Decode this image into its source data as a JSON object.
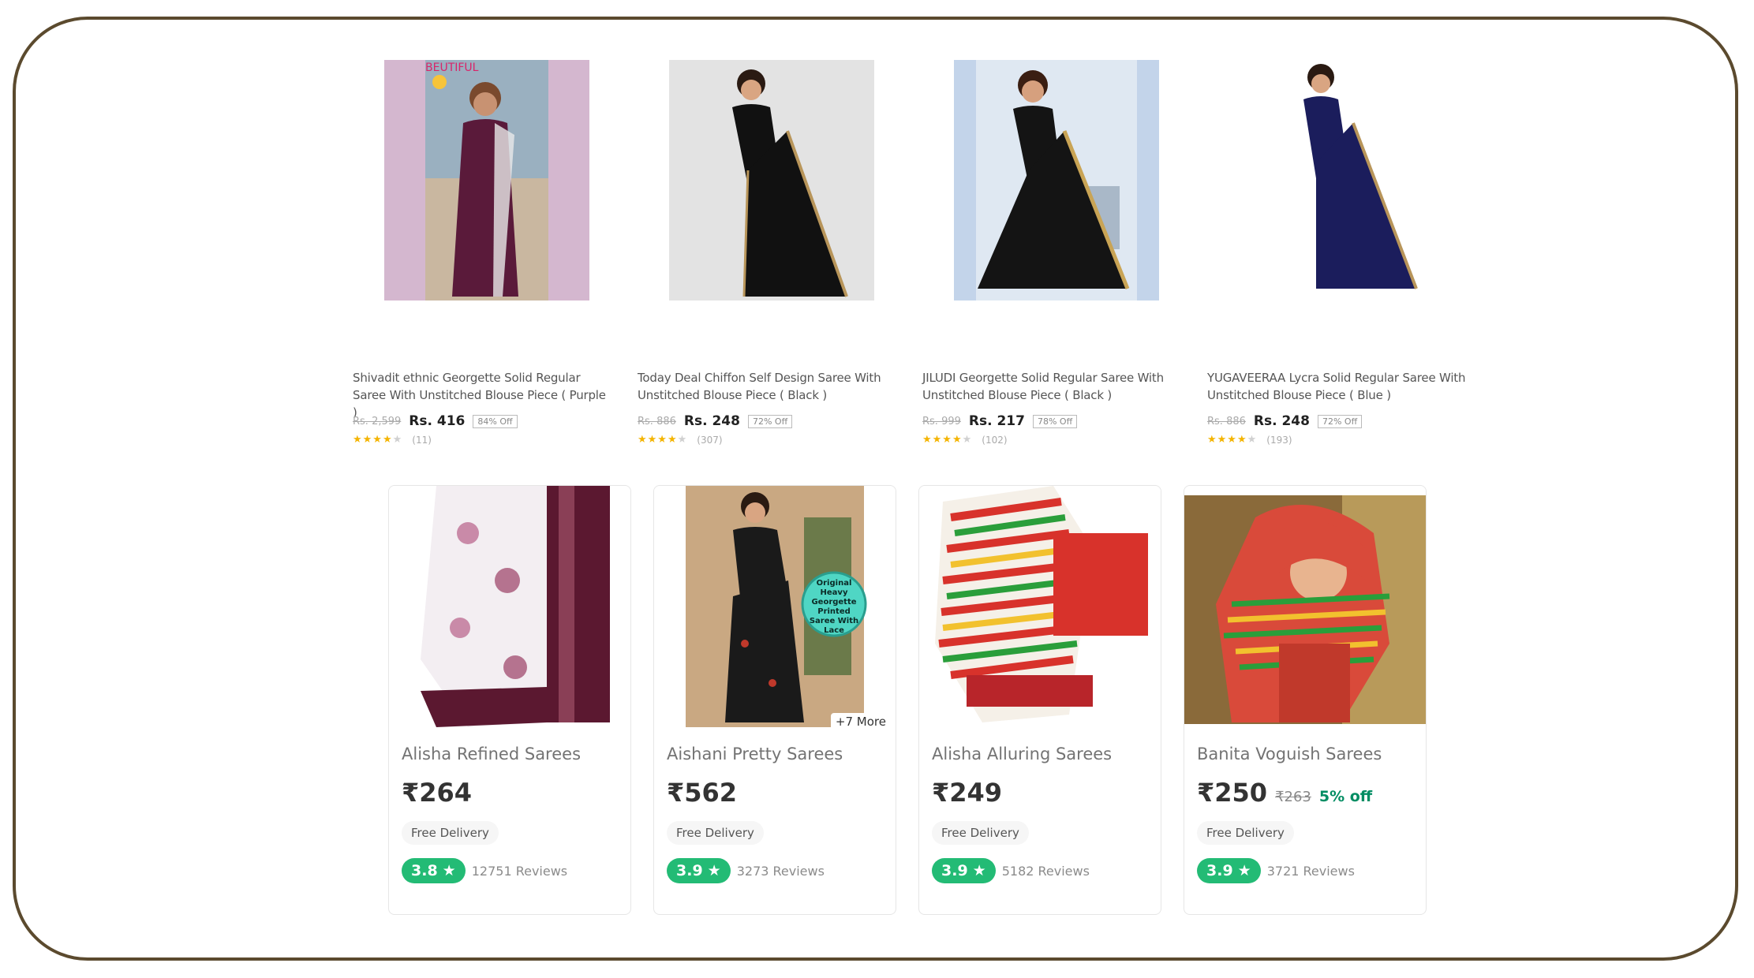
{
  "top_products": [
    {
      "title": "Shivadit ethnic Georgette Solid Regular Saree With Unstitched Blouse Piece ( Purple )",
      "mrp": "Rs. 2,599",
      "price": "Rs. 416",
      "off": "84% Off",
      "rating_stars": 3.5,
      "review_count": "(11)",
      "image_overlay": "BEUTIFUL",
      "bg": "#d4b7cf",
      "saree": "#5a1a3a",
      "border": "#e8e8e8"
    },
    {
      "title": "Today Deal Chiffon Self Design Saree With Unstitched Blouse Piece ( Black )",
      "mrp": "Rs. 886",
      "price": "Rs. 248",
      "off": "72% Off",
      "rating_stars": 4,
      "review_count": "(307)",
      "bg": "#e3e3e3",
      "saree": "#111111",
      "border": "#b8955a"
    },
    {
      "title": "JILUDI Georgette Solid Regular Saree With Unstitched Blouse Piece ( Black )",
      "mrp": "Rs. 999",
      "price": "Rs. 217",
      "off": "78% Off",
      "rating_stars": 4,
      "review_count": "(102)",
      "bg": "#c3d4ea",
      "saree": "#141414",
      "border": "#c9a455"
    },
    {
      "title": "YUGAVEERAA Lycra Solid Regular Saree With Unstitched Blouse Piece ( Blue )",
      "mrp": "Rs. 886",
      "price": "Rs. 248",
      "off": "72% Off",
      "rating_stars": 3.5,
      "review_count": "(193)",
      "bg": "#ffffff",
      "saree": "#1b1d5c",
      "border": "#b8955a"
    }
  ],
  "bottom_products": [
    {
      "name": "Alisha Refined Sarees",
      "price": "₹264",
      "delivery": "Free Delivery",
      "rating": "3.8",
      "reviews": "12751 Reviews",
      "bg": "#f3eef2",
      "saree": "#5b1830"
    },
    {
      "name": "Aishani Pretty Sarees",
      "price": "₹562",
      "delivery": "Free Delivery",
      "rating": "3.9",
      "reviews": "3273 Reviews",
      "more": "+7 More",
      "badge": "Original Heavy Georgette Printed Saree With Lace",
      "bg": "#c9a882",
      "saree": "#1a1a1a"
    },
    {
      "name": "Alisha Alluring Sarees",
      "price": "₹249",
      "delivery": "Free Delivery",
      "rating": "3.9",
      "reviews": "5182 Reviews",
      "bg": "#ffffff",
      "saree": "#d8322b"
    },
    {
      "name": "Banita Voguish Sarees",
      "price": "₹250",
      "mrp": "₹263",
      "off": "5% off",
      "delivery": "Free Delivery",
      "rating": "3.9",
      "reviews": "3721 Reviews",
      "bg": "#8a6a3a",
      "saree": "#d94a3a"
    }
  ]
}
